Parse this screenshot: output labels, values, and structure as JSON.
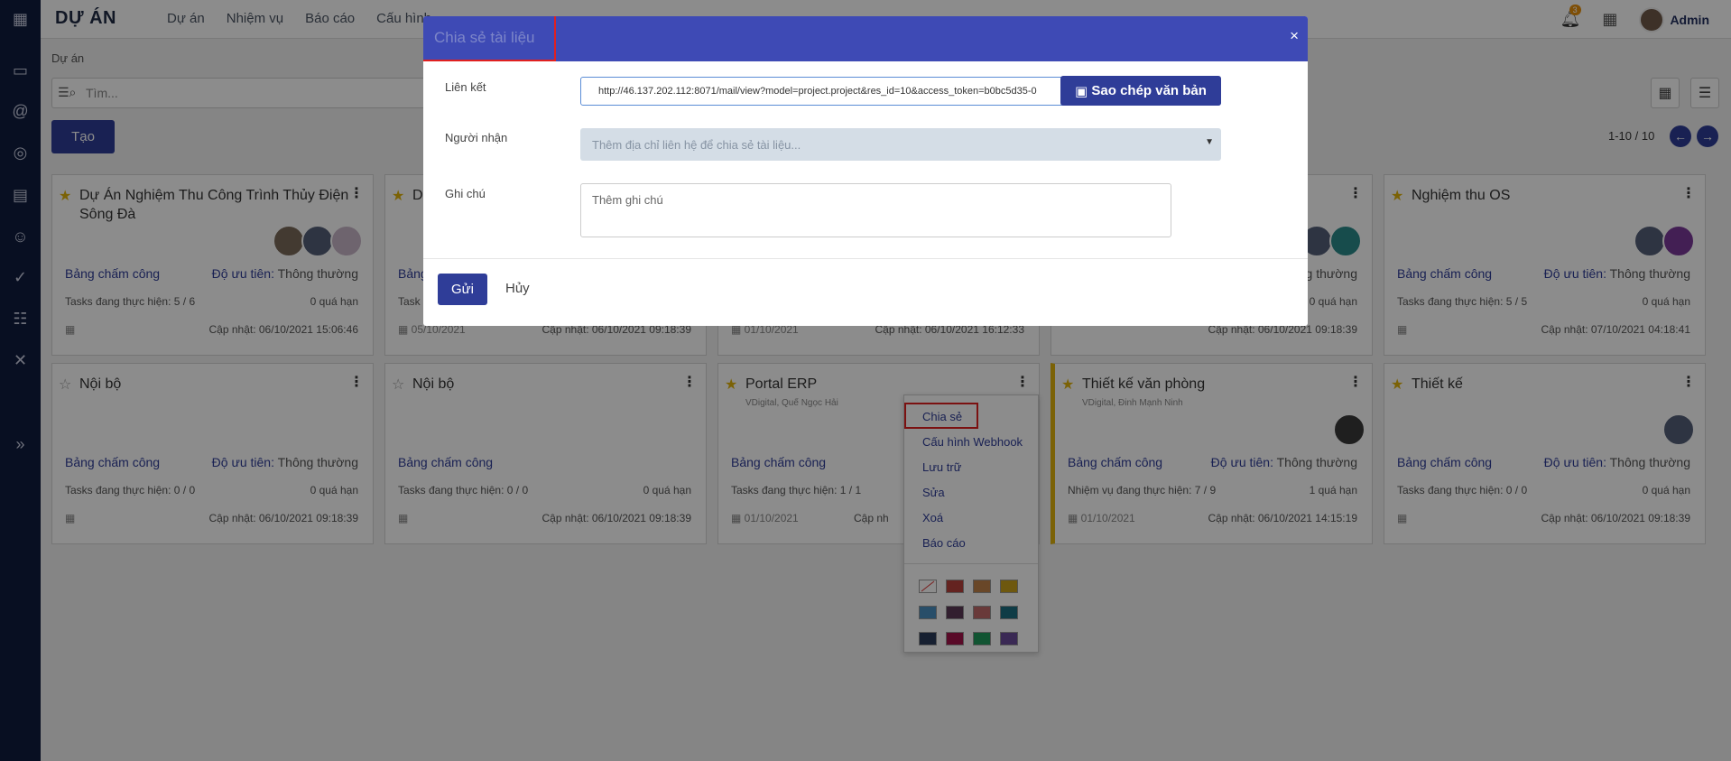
{
  "app": {
    "title": "DỰ ÁN",
    "menu": [
      "Dự án",
      "Nhiệm vụ",
      "Báo cáo",
      "Cấu hình"
    ],
    "notification_count": "3",
    "user": "Admin"
  },
  "breadcrumb": "Dự án",
  "search": {
    "placeholder": "Tìm..."
  },
  "create_label": "Tạo",
  "pager": "1-10 / 10",
  "cards": [
    {
      "title": "Dự Án Nghiệm Thu Công Trình Thủy Điện Sông Đà",
      "starred": true,
      "sub": "",
      "left1": "Bảng chấm công",
      "right1_label": "Độ ưu tiên:",
      "right1_value": "Thông thường",
      "left2": "Tasks đang thực hiện: 5 / 6",
      "right2": "0 quá hạn",
      "date": "",
      "updated": "Cập nhật: 06/10/2021 15:06:46"
    },
    {
      "title": "D",
      "starred": true,
      "sub": "",
      "left1": "Bảng",
      "right1_label": "",
      "right1_value": "",
      "left2": "Task",
      "right2": "",
      "date": "05/10/2021",
      "updated": "Cập nhật: 06/10/2021 09:18:39"
    },
    {
      "title": "",
      "starred": false,
      "sub": "",
      "left1": "",
      "right1_label": "",
      "right1_value": "",
      "left2": "",
      "right2": "",
      "date": "01/10/2021",
      "updated": "Cập nhật: 06/10/2021 16:12:33"
    },
    {
      "title": "",
      "starred": false,
      "sub": "",
      "left1": "",
      "right1_label": "",
      "right1_value": "Thông thường",
      "left2": "",
      "right2": "0 quá hạn",
      "date": "",
      "updated": "Cập nhật: 06/10/2021 09:18:39"
    },
    {
      "title": "Nghiệm thu OS",
      "starred": true,
      "sub": "",
      "left1": "Bảng chấm công",
      "right1_label": "Độ ưu tiên:",
      "right1_value": "Thông thường",
      "left2": "Tasks đang thực hiện: 5 / 5",
      "right2": "0 quá hạn",
      "date": "",
      "updated": "Cập nhật: 07/10/2021 04:18:41"
    },
    {
      "title": "Nội bộ",
      "starred": false,
      "sub": "",
      "left1": "Bảng chấm công",
      "right1_label": "Độ ưu tiên:",
      "right1_value": "Thông thường",
      "left2": "Tasks đang thực hiện: 0 / 0",
      "right2": "0 quá hạn",
      "date": "",
      "updated": "Cập nhật: 06/10/2021 09:18:39"
    },
    {
      "title": "Nội bộ",
      "starred": false,
      "sub": "",
      "left1": "Bảng chấm công",
      "right1_label": "",
      "right1_value": "",
      "left2": "Tasks đang thực hiện: 0 / 0",
      "right2": "0 quá hạn",
      "date": "",
      "updated": "Cập nhật: 06/10/2021 09:18:39"
    },
    {
      "title": "Portal ERP",
      "starred": true,
      "sub": "VDigital, Quế Ngọc Hải",
      "left1": "Bảng chấm công",
      "right1_label": "",
      "right1_value": "",
      "left2": "Tasks đang thực hiện: 1 / 1",
      "right2": "",
      "date": "01/10/2021",
      "updated": "Cập nh"
    },
    {
      "title": "Thiết kế văn phòng",
      "starred": true,
      "sub": "VDigital, Đinh Mạnh Ninh",
      "left1": "Bảng chấm công",
      "right1_label": "Độ ưu tiên:",
      "right1_value": "Thông thường",
      "left2": "Nhiệm vụ đang thực hiện: 7 / 9",
      "right2": "1 quá hạn",
      "date": "01/10/2021",
      "updated": "Cập nhật: 06/10/2021 14:15:19"
    },
    {
      "title": "Thiết kế",
      "starred": true,
      "sub": "",
      "left1": "Bảng chấm công",
      "right1_label": "Độ ưu tiên:",
      "right1_value": "Thông thường",
      "left2": "Tasks đang thực hiện: 0 / 0",
      "right2": "0 quá hạn",
      "date": "",
      "updated": "Cập nhật: 06/10/2021 09:18:39"
    }
  ],
  "modal": {
    "title": "Chia sẻ tài liệu",
    "close": "×",
    "link_label": "Liên kết",
    "link_value": "http://46.137.202.112:8071/mail/view?model=project.project&res_id=10&access_token=b0bc5d35-0",
    "copy_label": "Sao chép văn bản",
    "recipient_label": "Người nhận",
    "recipient_placeholder": "Thêm địa chỉ liên hệ để chia sẻ tài liệu...",
    "note_label": "Ghi chú",
    "note_placeholder": "Thêm ghi chú",
    "send_label": "Gửi",
    "cancel_label": "Hủy"
  },
  "dropdown": {
    "items": [
      "Chia sẻ",
      "Cấu hình Webhook",
      "Lưu trữ",
      "Sửa",
      "Xoá",
      "Báo cáo"
    ],
    "colors": [
      "#ffffff",
      "#b6403b",
      "#c0814a",
      "#c9a11c",
      "#4a8fbf",
      "#5c3a56",
      "#c06b6b",
      "#1d6d80",
      "#2b3b5a",
      "#a3134a",
      "#1f9a5c",
      "#6b4c9a"
    ]
  },
  "colors": {
    "brand": "#2f3d98",
    "modal_header": "#3e4ab5",
    "star": "#e1b30b",
    "highlight": "#e02020"
  }
}
